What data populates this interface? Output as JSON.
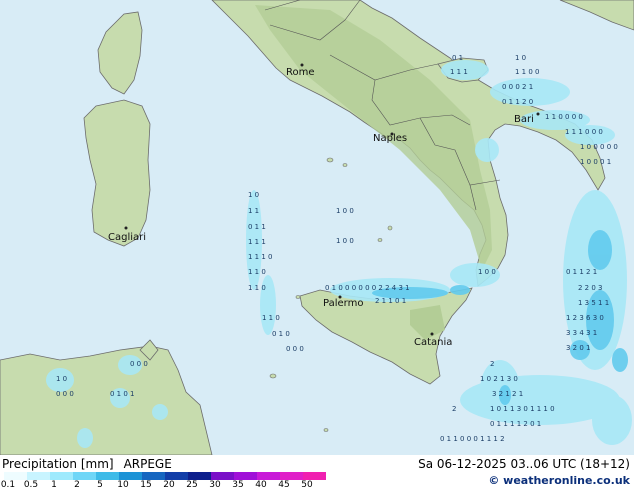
{
  "map": {
    "cities": [
      "Rome",
      "Naples",
      "Bari",
      "Cagliari",
      "Palermo",
      "Catania"
    ],
    "value_rows": [
      {
        "id": "r1",
        "text": "0 1"
      },
      {
        "id": "r2",
        "text": "1 1 1"
      },
      {
        "id": "r3",
        "text": "1 0"
      },
      {
        "id": "r4",
        "text": "1 1 0 0"
      },
      {
        "id": "r5",
        "text": "0 0 0 2 1"
      },
      {
        "id": "r6",
        "text": "0 1 1 2 0"
      },
      {
        "id": "r7",
        "text": "1 1 0 0 0 0"
      },
      {
        "id": "r8",
        "text": "1 1 1 0 0 0"
      },
      {
        "id": "r9",
        "text": "1 0 0 0 0 0"
      },
      {
        "id": "r10",
        "text": "1 0 0 0 1"
      },
      {
        "id": "r11",
        "text": "1 0"
      },
      {
        "id": "r12",
        "text": "1 1"
      },
      {
        "id": "r13",
        "text": "0 1 1"
      },
      {
        "id": "r14",
        "text": "1 1 1"
      },
      {
        "id": "r15",
        "text": "1 1 1 0"
      },
      {
        "id": "r16",
        "text": "1 1 0"
      },
      {
        "id": "r17",
        "text": "1 1 0"
      },
      {
        "id": "r18",
        "text": "1 1 0"
      },
      {
        "id": "r19",
        "text": "0 1 0"
      },
      {
        "id": "r20",
        "text": "0 0 0"
      },
      {
        "id": "r21",
        "text": "0 1 0 0 0 0 0 0 2 2 4 3 1"
      },
      {
        "id": "r22",
        "text": "2 1 1 0 1"
      },
      {
        "id": "r23",
        "text": "1 0 0"
      },
      {
        "id": "r24",
        "text": "0 1 1 2 1"
      },
      {
        "id": "r25",
        "text": "2 2 0 3"
      },
      {
        "id": "r26",
        "text": "1 3 5 1 1"
      },
      {
        "id": "r27",
        "text": "1 2 3 6 3 0"
      },
      {
        "id": "r28",
        "text": "3 3 4 3 1"
      },
      {
        "id": "r29",
        "text": "3 2 0 1"
      },
      {
        "id": "r30",
        "text": "1 0 2 1 3 0"
      },
      {
        "id": "r31",
        "text": "3 2 1 2 1"
      },
      {
        "id": "r32",
        "text": "1 0 1 1 3 0 1 1 1 0"
      },
      {
        "id": "r33",
        "text": "0 1 1 1 1 2 0 1"
      },
      {
        "id": "r34",
        "text": "0 1 1 0 0 0 1 1 1 2"
      },
      {
        "id": "r35",
        "text": "1 0"
      },
      {
        "id": "r36",
        "text": "0 0 0"
      },
      {
        "id": "r37",
        "text": "0 1 0 1"
      },
      {
        "id": "r38",
        "text": "0 0 0"
      },
      {
        "id": "r39",
        "text": "1 0 0"
      },
      {
        "id": "r40",
        "text": "1 0 0"
      },
      {
        "id": "r41",
        "text": "2"
      },
      {
        "id": "r42",
        "text": "2"
      }
    ]
  },
  "legend": {
    "title": "Precipitation [mm]",
    "model": "ARPEGE",
    "valid_time": "Sa 06-12-2025 03..06 UTC (18+12)",
    "credit": "© weatheronline.co.uk",
    "scale_labels": [
      "0.1",
      "0.5",
      "1",
      "2",
      "5",
      "10",
      "15",
      "20",
      "25",
      "30",
      "35",
      "40",
      "45",
      "50"
    ],
    "scale_colors": [
      "#eefcff",
      "#c8f4ff",
      "#9eeafd",
      "#6fd6f7",
      "#3ebbe8",
      "#1c93d6",
      "#1666c0",
      "#123ea8",
      "#0d1f8c",
      "#7a10c8",
      "#a010d8",
      "#c81ad8",
      "#e020c8",
      "#f020b0"
    ]
  }
}
